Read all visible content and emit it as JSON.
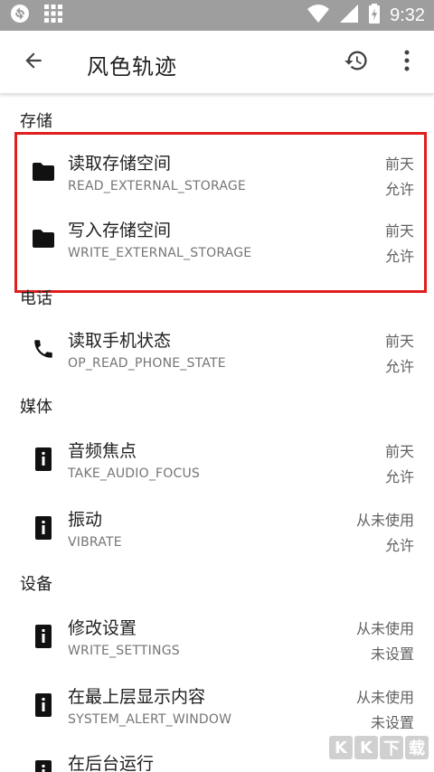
{
  "status_bar": {
    "time": "9:32",
    "icons": [
      "sync-icon",
      "grid-icon",
      "wifi-icon",
      "signal-icon",
      "battery-icon"
    ]
  },
  "app_bar": {
    "title": "风色轨迹",
    "back_icon": "arrow-back-icon",
    "history_icon": "history-icon",
    "more_icon": "more-vert-icon"
  },
  "sections": [
    {
      "header": "存储",
      "items": [
        {
          "name": "读取存储空间",
          "code": "READ_EXTERNAL_STORAGE",
          "time": "前天",
          "mode": "允许",
          "icon": "folder-icon"
        },
        {
          "name": "写入存储空间",
          "code": "WRITE_EXTERNAL_STORAGE",
          "time": "前天",
          "mode": "允许",
          "icon": "folder-icon"
        }
      ]
    },
    {
      "header": "电话",
      "items": [
        {
          "name": "读取手机状态",
          "code": "OP_READ_PHONE_STATE",
          "time": "前天",
          "mode": "允许",
          "icon": "phone-icon"
        }
      ]
    },
    {
      "header": "媒体",
      "items": [
        {
          "name": "音频焦点",
          "code": "TAKE_AUDIO_FOCUS",
          "time": "前天",
          "mode": "允许",
          "icon": "device-info-icon"
        },
        {
          "name": "振动",
          "code": "VIBRATE",
          "time": "从未使用",
          "mode": "允许",
          "icon": "device-info-icon"
        }
      ]
    },
    {
      "header": "设备",
      "items": [
        {
          "name": "修改设置",
          "code": "WRITE_SETTINGS",
          "time": "从未使用",
          "mode": "未设置",
          "icon": "device-info-icon"
        },
        {
          "name": "在最上层显示内容",
          "code": "SYSTEM_ALERT_WINDOW",
          "time": "从未使用",
          "mode": "未设置",
          "icon": "device-info-icon"
        },
        {
          "name": "在后台运行",
          "code": "",
          "time": "",
          "mode": "",
          "icon": "device-info-icon"
        }
      ]
    }
  ],
  "watermark": {
    "text": "KK下载",
    "url": "www.kk..."
  },
  "colors": {
    "status_bar": "#9e9e9e",
    "highlight_border": "#e01e1e",
    "primary_text": "#212121",
    "secondary_text": "#757575"
  }
}
